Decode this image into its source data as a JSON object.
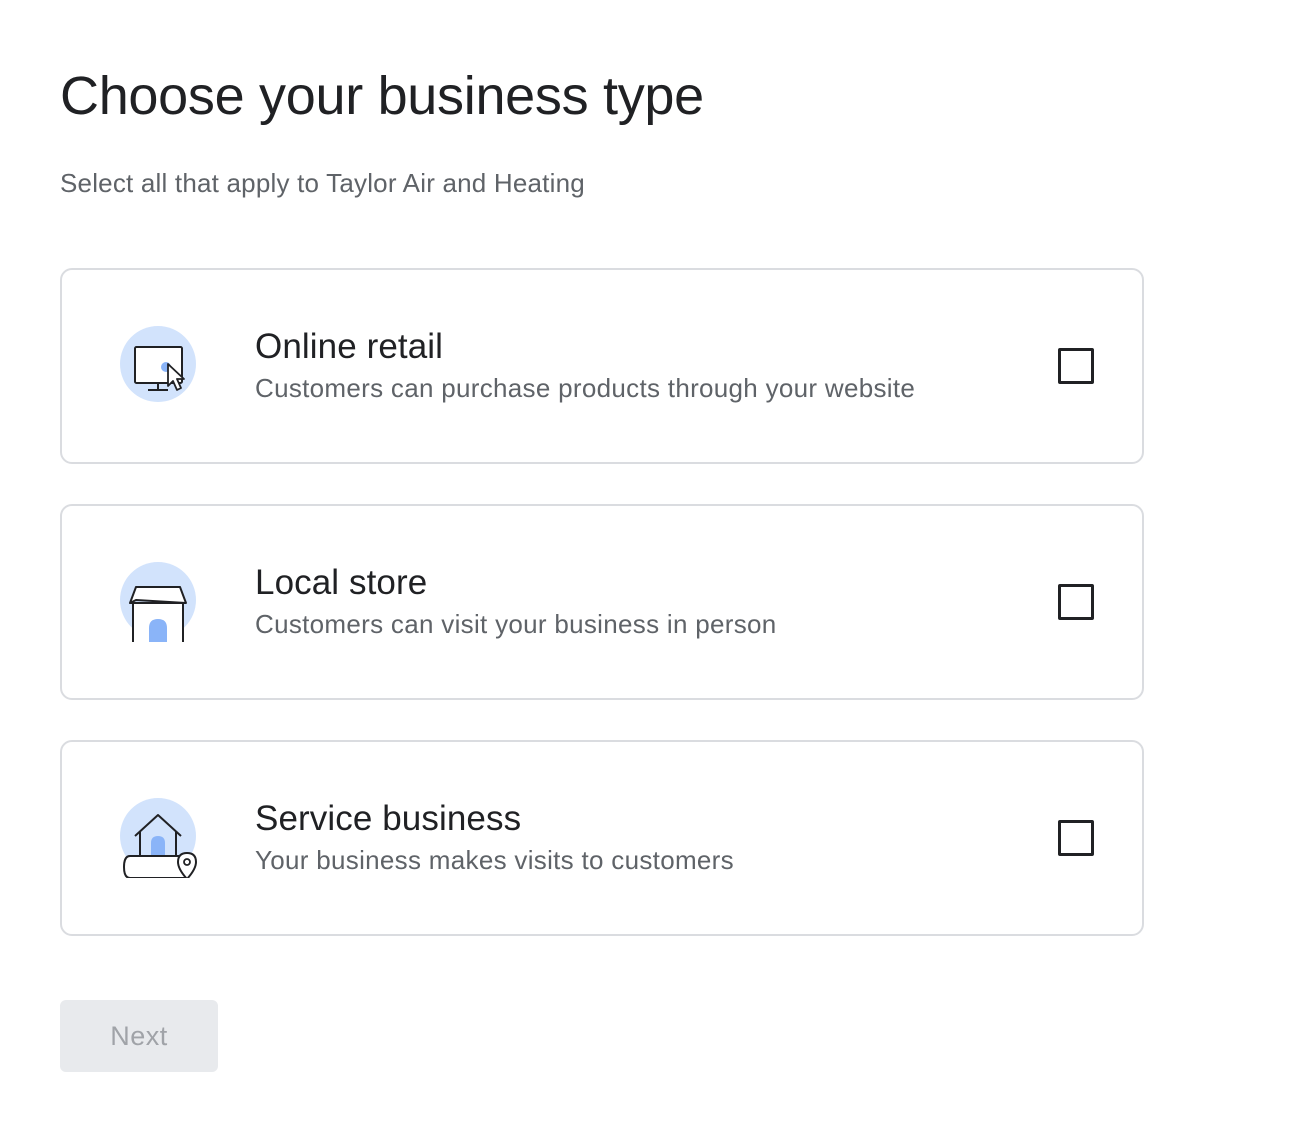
{
  "header": {
    "title": "Choose your business type",
    "subtitle": "Select all that apply to Taylor Air and Heating"
  },
  "options": [
    {
      "title": "Online retail",
      "description": "Customers can purchase products through your website",
      "icon": "computer-cursor-icon",
      "checked": false
    },
    {
      "title": "Local store",
      "description": "Customers can visit your business in person",
      "icon": "storefront-icon",
      "checked": false
    },
    {
      "title": "Service business",
      "description": "Your business makes visits to customers",
      "icon": "house-location-icon",
      "checked": false
    }
  ],
  "footer": {
    "next_label": "Next",
    "next_enabled": false
  },
  "colors": {
    "icon_circle": "#d2e3fc",
    "icon_accent": "#8ab4f8",
    "card_border": "#dadce0",
    "button_disabled_bg": "#e8eaed",
    "button_disabled_text": "#a0a3a8"
  }
}
